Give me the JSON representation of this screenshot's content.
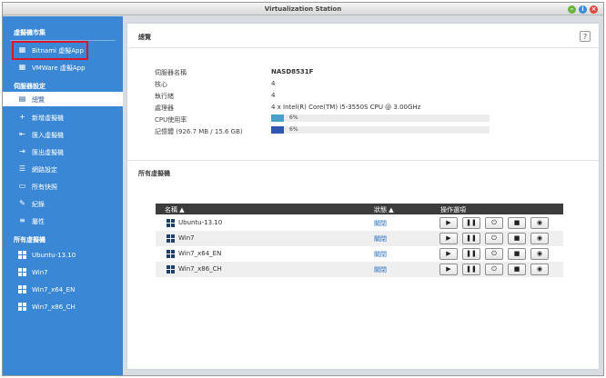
{
  "window": {
    "title": "Virtualization Station"
  },
  "sidebar": {
    "section_vm_center": "虛擬機市集",
    "market_items": [
      {
        "label": "Bitnami 虛擬App",
        "icon": "bitnami-icon"
      },
      {
        "label": "VMWare 虛擬App",
        "icon": "vmware-icon"
      }
    ],
    "section_server_settings": "伺服器設定",
    "settings_items": [
      {
        "label": "總覽",
        "icon": "overview-icon"
      },
      {
        "label": "新增虛擬機",
        "icon": "plus-icon"
      },
      {
        "label": "匯入虛擬機",
        "icon": "import-icon"
      },
      {
        "label": "匯出虛擬機",
        "icon": "export-icon"
      },
      {
        "label": "網路設定",
        "icon": "network-icon"
      },
      {
        "label": "所有快照",
        "icon": "snapshot-icon"
      },
      {
        "label": "紀錄",
        "icon": "log-icon"
      },
      {
        "label": "屬性",
        "icon": "properties-icon"
      }
    ],
    "section_all_vms": "所有虛擬機",
    "vm_items": [
      {
        "label": "Ubuntu-13.10"
      },
      {
        "label": "Win7"
      },
      {
        "label": "Win7_x64_EN"
      },
      {
        "label": "Win7_x86_CH"
      }
    ]
  },
  "overview": {
    "title": "總覽",
    "help": "?",
    "host_name_label": "伺服器名稱",
    "host_name_value": "NASD8531F",
    "cores_label": "核心",
    "cores_value": "4",
    "threads_label": "執行緒",
    "threads_value": "4",
    "processor_label": "處理器",
    "processor_value": "4 x Intel(R) Core(TM) i5-3550S CPU @ 3.00GHz",
    "cpu_label": "CPU使用率",
    "cpu_percent_text": "6%",
    "cpu_fraction": 0.06,
    "cpu_color": "#49a3c8",
    "memory_label": "記憶體 (926.7 MB / 15.6 GB)",
    "memory_percent_text": "6%",
    "memory_fraction": 0.06,
    "memory_color": "#2f56b0"
  },
  "vm_table": {
    "section_title": "所有虛擬機",
    "col_name": "名稱 ▲",
    "col_state": "狀態 ▲",
    "col_actions": "操作選項",
    "rows": [
      {
        "name": "Ubuntu-13.10",
        "state": "關閉",
        "os_icon": "windows-icon"
      },
      {
        "name": "Win7",
        "state": "關閉",
        "os_icon": "windows-icon"
      },
      {
        "name": "Win7_x64_EN",
        "state": "關閉",
        "os_icon": "windows-icon"
      },
      {
        "name": "Win7_x86_CH",
        "state": "關閉",
        "os_icon": "windows-icon"
      }
    ],
    "action_buttons": [
      {
        "icon": "play-icon",
        "glyph": "▶"
      },
      {
        "icon": "pause-icon",
        "glyph": "❚❚"
      },
      {
        "icon": "power-icon",
        "glyph": "⏻"
      },
      {
        "icon": "stop-icon",
        "glyph": "■"
      },
      {
        "icon": "view-icon",
        "glyph": "◉"
      }
    ]
  },
  "colors": {
    "sidebar_bg": "#3a87d6",
    "highlight_border": "#d9172a",
    "table_header": "#3c3c3c",
    "link": "#2a6fbf"
  }
}
